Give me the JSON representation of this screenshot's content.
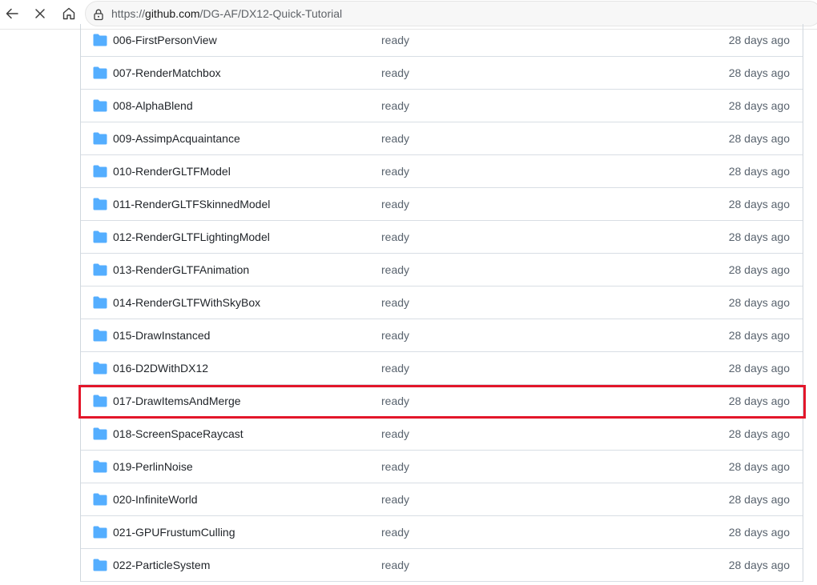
{
  "browser": {
    "url_scheme": "https://",
    "url_host": "github.com",
    "url_path": "/DG-AF/DX12-Quick-Tutorial"
  },
  "files": [
    {
      "name": "006-FirstPersonView",
      "message": "ready",
      "date": "28 days ago"
    },
    {
      "name": "007-RenderMatchbox",
      "message": "ready",
      "date": "28 days ago"
    },
    {
      "name": "008-AlphaBlend",
      "message": "ready",
      "date": "28 days ago"
    },
    {
      "name": "009-AssimpAcquaintance",
      "message": "ready",
      "date": "28 days ago"
    },
    {
      "name": "010-RenderGLTFModel",
      "message": "ready",
      "date": "28 days ago"
    },
    {
      "name": "011-RenderGLTFSkinnedModel",
      "message": "ready",
      "date": "28 days ago"
    },
    {
      "name": "012-RenderGLTFLightingModel",
      "message": "ready",
      "date": "28 days ago"
    },
    {
      "name": "013-RenderGLTFAnimation",
      "message": "ready",
      "date": "28 days ago"
    },
    {
      "name": "014-RenderGLTFWithSkyBox",
      "message": "ready",
      "date": "28 days ago"
    },
    {
      "name": "015-DrawInstanced",
      "message": "ready",
      "date": "28 days ago"
    },
    {
      "name": "016-D2DWithDX12",
      "message": "ready",
      "date": "28 days ago"
    },
    {
      "name": "017-DrawItemsAndMerge",
      "message": "ready",
      "date": "28 days ago"
    },
    {
      "name": "018-ScreenSpaceRaycast",
      "message": "ready",
      "date": "28 days ago"
    },
    {
      "name": "019-PerlinNoise",
      "message": "ready",
      "date": "28 days ago"
    },
    {
      "name": "020-InfiniteWorld",
      "message": "ready",
      "date": "28 days ago"
    },
    {
      "name": "021-GPUFrustumCulling",
      "message": "ready",
      "date": "28 days ago"
    },
    {
      "name": "022-ParticleSystem",
      "message": "ready",
      "date": "28 days ago"
    }
  ],
  "colors": {
    "folder_icon": "#54aeff",
    "highlight_box": "#e3162a",
    "muted_text": "#59636e"
  },
  "icons": {
    "back": "arrow-left-icon",
    "stop": "close-icon",
    "home": "home-icon",
    "lock": "lock-icon",
    "folder": "folder-icon"
  }
}
